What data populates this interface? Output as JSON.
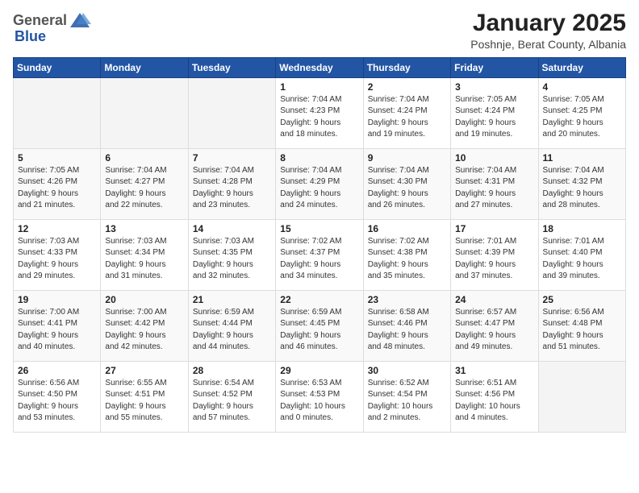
{
  "header": {
    "logo_general": "General",
    "logo_blue": "Blue",
    "title": "January 2025",
    "subtitle": "Poshnje, Berat County, Albania"
  },
  "days_of_week": [
    "Sunday",
    "Monday",
    "Tuesday",
    "Wednesday",
    "Thursday",
    "Friday",
    "Saturday"
  ],
  "weeks": [
    [
      {
        "day": "",
        "info": ""
      },
      {
        "day": "",
        "info": ""
      },
      {
        "day": "",
        "info": ""
      },
      {
        "day": "1",
        "info": "Sunrise: 7:04 AM\nSunset: 4:23 PM\nDaylight: 9 hours\nand 18 minutes."
      },
      {
        "day": "2",
        "info": "Sunrise: 7:04 AM\nSunset: 4:24 PM\nDaylight: 9 hours\nand 19 minutes."
      },
      {
        "day": "3",
        "info": "Sunrise: 7:05 AM\nSunset: 4:24 PM\nDaylight: 9 hours\nand 19 minutes."
      },
      {
        "day": "4",
        "info": "Sunrise: 7:05 AM\nSunset: 4:25 PM\nDaylight: 9 hours\nand 20 minutes."
      }
    ],
    [
      {
        "day": "5",
        "info": "Sunrise: 7:05 AM\nSunset: 4:26 PM\nDaylight: 9 hours\nand 21 minutes."
      },
      {
        "day": "6",
        "info": "Sunrise: 7:04 AM\nSunset: 4:27 PM\nDaylight: 9 hours\nand 22 minutes."
      },
      {
        "day": "7",
        "info": "Sunrise: 7:04 AM\nSunset: 4:28 PM\nDaylight: 9 hours\nand 23 minutes."
      },
      {
        "day": "8",
        "info": "Sunrise: 7:04 AM\nSunset: 4:29 PM\nDaylight: 9 hours\nand 24 minutes."
      },
      {
        "day": "9",
        "info": "Sunrise: 7:04 AM\nSunset: 4:30 PM\nDaylight: 9 hours\nand 26 minutes."
      },
      {
        "day": "10",
        "info": "Sunrise: 7:04 AM\nSunset: 4:31 PM\nDaylight: 9 hours\nand 27 minutes."
      },
      {
        "day": "11",
        "info": "Sunrise: 7:04 AM\nSunset: 4:32 PM\nDaylight: 9 hours\nand 28 minutes."
      }
    ],
    [
      {
        "day": "12",
        "info": "Sunrise: 7:03 AM\nSunset: 4:33 PM\nDaylight: 9 hours\nand 29 minutes."
      },
      {
        "day": "13",
        "info": "Sunrise: 7:03 AM\nSunset: 4:34 PM\nDaylight: 9 hours\nand 31 minutes."
      },
      {
        "day": "14",
        "info": "Sunrise: 7:03 AM\nSunset: 4:35 PM\nDaylight: 9 hours\nand 32 minutes."
      },
      {
        "day": "15",
        "info": "Sunrise: 7:02 AM\nSunset: 4:37 PM\nDaylight: 9 hours\nand 34 minutes."
      },
      {
        "day": "16",
        "info": "Sunrise: 7:02 AM\nSunset: 4:38 PM\nDaylight: 9 hours\nand 35 minutes."
      },
      {
        "day": "17",
        "info": "Sunrise: 7:01 AM\nSunset: 4:39 PM\nDaylight: 9 hours\nand 37 minutes."
      },
      {
        "day": "18",
        "info": "Sunrise: 7:01 AM\nSunset: 4:40 PM\nDaylight: 9 hours\nand 39 minutes."
      }
    ],
    [
      {
        "day": "19",
        "info": "Sunrise: 7:00 AM\nSunset: 4:41 PM\nDaylight: 9 hours\nand 40 minutes."
      },
      {
        "day": "20",
        "info": "Sunrise: 7:00 AM\nSunset: 4:42 PM\nDaylight: 9 hours\nand 42 minutes."
      },
      {
        "day": "21",
        "info": "Sunrise: 6:59 AM\nSunset: 4:44 PM\nDaylight: 9 hours\nand 44 minutes."
      },
      {
        "day": "22",
        "info": "Sunrise: 6:59 AM\nSunset: 4:45 PM\nDaylight: 9 hours\nand 46 minutes."
      },
      {
        "day": "23",
        "info": "Sunrise: 6:58 AM\nSunset: 4:46 PM\nDaylight: 9 hours\nand 48 minutes."
      },
      {
        "day": "24",
        "info": "Sunrise: 6:57 AM\nSunset: 4:47 PM\nDaylight: 9 hours\nand 49 minutes."
      },
      {
        "day": "25",
        "info": "Sunrise: 6:56 AM\nSunset: 4:48 PM\nDaylight: 9 hours\nand 51 minutes."
      }
    ],
    [
      {
        "day": "26",
        "info": "Sunrise: 6:56 AM\nSunset: 4:50 PM\nDaylight: 9 hours\nand 53 minutes."
      },
      {
        "day": "27",
        "info": "Sunrise: 6:55 AM\nSunset: 4:51 PM\nDaylight: 9 hours\nand 55 minutes."
      },
      {
        "day": "28",
        "info": "Sunrise: 6:54 AM\nSunset: 4:52 PM\nDaylight: 9 hours\nand 57 minutes."
      },
      {
        "day": "29",
        "info": "Sunrise: 6:53 AM\nSunset: 4:53 PM\nDaylight: 10 hours\nand 0 minutes."
      },
      {
        "day": "30",
        "info": "Sunrise: 6:52 AM\nSunset: 4:54 PM\nDaylight: 10 hours\nand 2 minutes."
      },
      {
        "day": "31",
        "info": "Sunrise: 6:51 AM\nSunset: 4:56 PM\nDaylight: 10 hours\nand 4 minutes."
      },
      {
        "day": "",
        "info": ""
      }
    ]
  ]
}
